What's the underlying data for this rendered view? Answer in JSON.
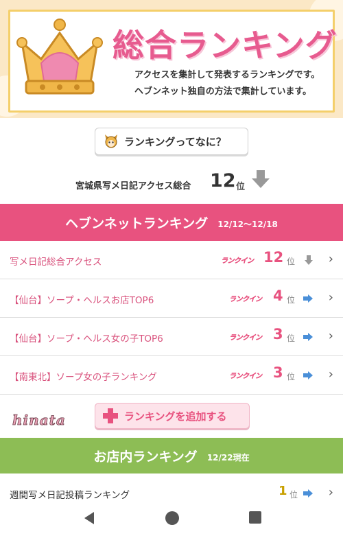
{
  "banner": {
    "title": "総合ランキング",
    "desc_line1": "アクセスを集計して発表するランキングです。",
    "desc_line2": "ヘブンネット独自の方法で集計しています。"
  },
  "about_button": {
    "label": "ランキングってなに？"
  },
  "summary": {
    "text": "宮城県写メ日記アクセス総合",
    "rank": "12",
    "unit": "位"
  },
  "heaven_section": {
    "title": "ヘブンネットランキング",
    "period": "12/12〜12/18",
    "rows": [
      {
        "name": "写メ日記総合アクセス",
        "badge": "ランクイン",
        "rank": "12",
        "unit": "位",
        "trend": "down"
      },
      {
        "name": "【仙台】ソープ・ヘルスお店TOP6",
        "badge": "ランクイン",
        "rank": "4",
        "unit": "位",
        "trend": "same"
      },
      {
        "name": "【仙台】ソープ・ヘルス女の子TOP6",
        "badge": "ランクイン",
        "rank": "3",
        "unit": "位",
        "trend": "same"
      },
      {
        "name": "【南東北】ソープ女の子ランキング",
        "badge": "ランクイン",
        "rank": "3",
        "unit": "位",
        "trend": "same"
      }
    ]
  },
  "add_button": {
    "label": "ランキングを追加する"
  },
  "logo": {
    "text": "hinata"
  },
  "shop_section": {
    "title": "お店内ランキング",
    "period": "12/22現在",
    "rows": [
      {
        "name": "週間写メ日記投稿ランキング",
        "rank": "1",
        "unit": "位",
        "trend": "same"
      }
    ]
  },
  "colors": {
    "pink": "#e8527f",
    "green": "#8dbd55",
    "gold": "#f4cf6a"
  },
  "icons": [
    "crown-icon",
    "character-icon",
    "down-arrow-icon",
    "right-arrow-icon",
    "chevron-right-icon",
    "plus-icon",
    "back-icon",
    "home-icon",
    "recents-icon"
  ]
}
